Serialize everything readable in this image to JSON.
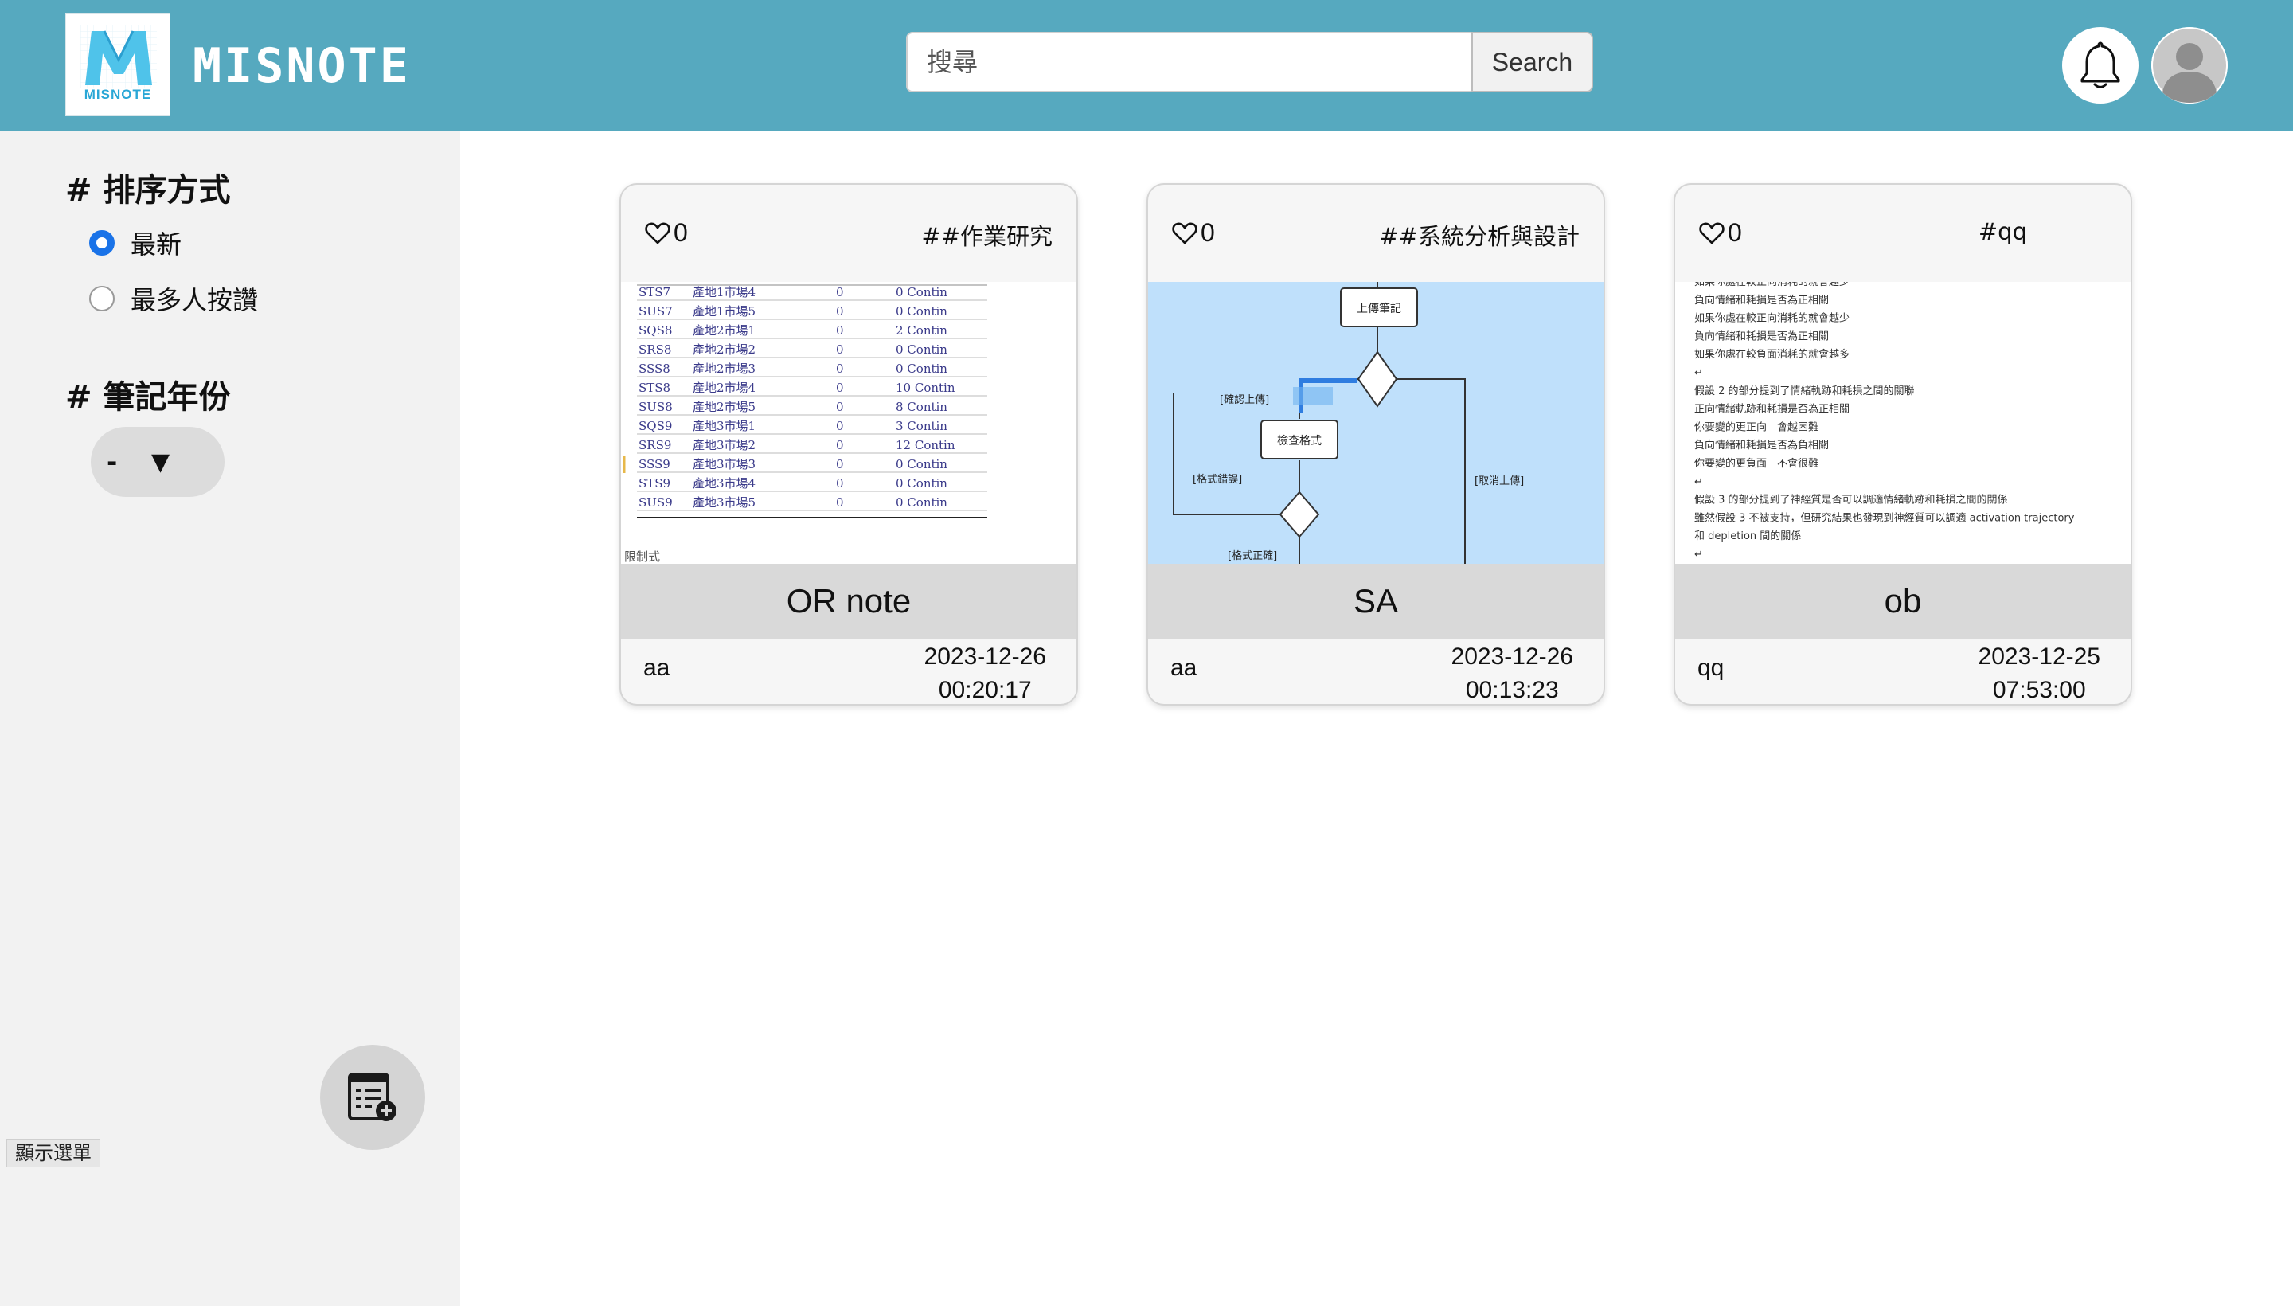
{
  "app": {
    "brand_name": "MISNOTE",
    "logo_subtitle": "MISNOTE",
    "logo_color": "#2aa7d6",
    "header_color": "#56a9bf"
  },
  "search": {
    "placeholder": "搜尋",
    "value": "",
    "button_label": "Search"
  },
  "header": {
    "notifications_icon": "bell-icon",
    "profile_icon": "user-avatar-icon"
  },
  "sidebar": {
    "sort_title": "# 排序方式",
    "sort_options": [
      {
        "label": "最新",
        "checked": true
      },
      {
        "label": "最多人按讚",
        "checked": false
      }
    ],
    "year_title": "# 筆記年份",
    "year_select": {
      "value": "-",
      "arrow": "▼"
    },
    "new_note_icon": "note-add-icon",
    "toggle_menu_label": "顯示選單"
  },
  "notes": [
    {
      "likes": "0",
      "tag": "##作業研究",
      "title": "OR note",
      "author": "aa",
      "date": "2023-12-26",
      "time": "00:20:17",
      "thumbnail": {
        "kind": "table",
        "rows": [
          [
            "STS7",
            "產地1市場4",
            "0",
            "0 Contin"
          ],
          [
            "SUS7",
            "產地1市場5",
            "0",
            "0 Contin"
          ],
          [
            "SQS8",
            "產地2市場1",
            "0",
            "2 Contin"
          ],
          [
            "SRS8",
            "產地2市場2",
            "0",
            "0 Contin"
          ],
          [
            "SSS8",
            "產地2市場3",
            "0",
            "0 Contin"
          ],
          [
            "STS8",
            "產地2市場4",
            "0",
            "10 Contin"
          ],
          [
            "SUS8",
            "產地2市場5",
            "0",
            "8 Contin"
          ],
          [
            "SQS9",
            "產地3市場1",
            "0",
            "3 Contin"
          ],
          [
            "SRS9",
            "產地3市場2",
            "0",
            "12 Contin"
          ],
          [
            "SSS9",
            "產地3市場3",
            "0",
            "0 Contin"
          ],
          [
            "STS9",
            "產地3市場4",
            "0",
            "0 Contin"
          ],
          [
            "SUS9",
            "產地3市場5",
            "0",
            "0 Contin"
          ]
        ],
        "footer": "限制式"
      }
    },
    {
      "likes": "0",
      "tag": "##系統分析與設計",
      "title": "SA",
      "author": "aa",
      "date": "2023-12-26",
      "time": "00:13:23",
      "thumbnail": {
        "kind": "flowchart",
        "labels": {
          "upload": "上傳筆記",
          "check": "檢查格式",
          "confirm": "[確認上傳]",
          "format_error": "[格式錯誤]",
          "cancel": "[取消上傳]",
          "format_ok": "[格式正確]"
        }
      }
    },
    {
      "likes": "0",
      "tag": "#qq",
      "title": "ob",
      "author": "qq",
      "date": "2023-12-25",
      "time": "07:53:00",
      "thumbnail": {
        "kind": "text",
        "lines": [
          "如果你處在較正向消耗的就會越少",
          "負向情緒和耗損是否為正相關",
          "如果你處在較正向消耗的就會越少",
          "負向情緒和耗損是否為正相關",
          "如果你處在較負面消耗的就會越多",
          "",
          "假設 2 的部分提到了情緒軌跡和耗損之間的關聯",
          "正向情緒軌跡和耗損是否為正相關",
          "你要變的更正向　會越困難",
          "負向情緒和耗損是否為負相關",
          "你要變的更負面　不會很難",
          "",
          "假設 3 的部分提到了神經質是否可以調適情緒軌跡和耗損之間的關係",
          "雖然假設 3 不被支持，但研究結果也發現到神經質可以調適 activation trajectory",
          "和 depletion 間的關係",
          ""
        ]
      }
    }
  ]
}
